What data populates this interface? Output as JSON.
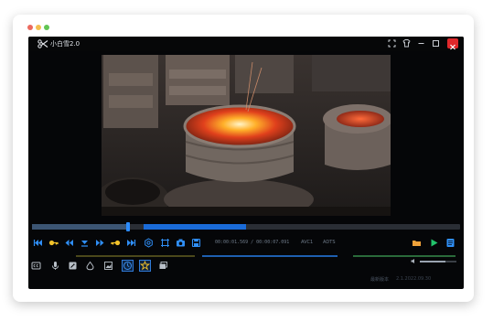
{
  "window": {
    "traffic_colors": [
      "#ec6a5e",
      "#f4bf4f",
      "#61c554"
    ]
  },
  "app": {
    "title": "小白雪2.0",
    "logo_icon": "scissors-icon",
    "controls": [
      "fullscreen-icon",
      "skin-icon",
      "minimize-icon",
      "maximize-icon",
      "close-icon"
    ]
  },
  "player": {
    "timecode": "00:00:01.569 / 00:00:07.091",
    "video_codec": "AVC1",
    "audio_codec": "ADTS",
    "progress": 0.22,
    "selection": [
      0.26,
      0.5
    ],
    "volume": 0.7,
    "colors": {
      "accent": "#1a6bd8",
      "highlight": "#f2c22a",
      "folder": "#f0a23a",
      "play": "#22c36b"
    }
  },
  "toolbar": {
    "transport": [
      "skip-to-start-icon",
      "set-start-key-icon",
      "step-back-icon",
      "mark-icon",
      "step-forward-icon",
      "set-end-key-icon",
      "skip-to-end-icon",
      "settings-icon",
      "crop-icon",
      "snapshot-icon",
      "save-icon"
    ],
    "right": [
      "open-folder-icon",
      "play-icon",
      "list-icon"
    ],
    "tools": [
      "subtitle-cc-icon",
      "microphone-icon",
      "edit-icon",
      "watermark-icon",
      "mosaic-icon",
      "speed-icon",
      "effects-icon",
      "layers-icon"
    ],
    "active_tools": [
      "speed-icon",
      "effects-icon"
    ]
  },
  "status": {
    "label": "最新版本",
    "value": "2.1.2022.09.30"
  }
}
